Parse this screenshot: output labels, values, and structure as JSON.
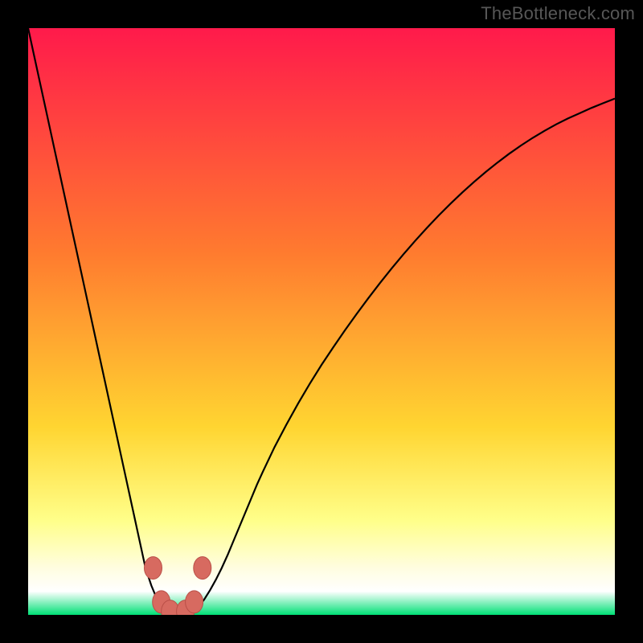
{
  "watermark": "TheBottleneck.com",
  "colors": {
    "frame": "#000000",
    "grad_top": "#ff1a4b",
    "grad_mid1": "#ff7a2f",
    "grad_mid2": "#ffd531",
    "grad_yellow_band": "#ffff8a",
    "grad_cream": "#fffde0",
    "grad_green": "#00e076",
    "curve": "#000000",
    "marker_fill": "#d76a60",
    "marker_stroke": "#b94f47"
  },
  "chart_data": {
    "type": "line",
    "title": "",
    "xlabel": "",
    "ylabel": "",
    "xlim": [
      0,
      100
    ],
    "ylim": [
      0,
      100
    ],
    "x": [
      0,
      1,
      2,
      3,
      4,
      5,
      6,
      7,
      8,
      9,
      10,
      11,
      12,
      13,
      14,
      15,
      16,
      17,
      18,
      19,
      20,
      21,
      22,
      23,
      24,
      25,
      26,
      27,
      28,
      29,
      30,
      31,
      32,
      33,
      34,
      35,
      36,
      37,
      38,
      39,
      40,
      42,
      44,
      46,
      48,
      50,
      52,
      54,
      56,
      58,
      60,
      62,
      64,
      66,
      68,
      70,
      72,
      74,
      76,
      78,
      80,
      82,
      84,
      86,
      88,
      90,
      92,
      94,
      96,
      98,
      100
    ],
    "y": [
      100,
      95.4,
      90.8,
      86.2,
      81.6,
      77.0,
      72.4,
      67.8,
      63.2,
      58.6,
      54.0,
      49.4,
      44.8,
      40.2,
      35.6,
      31.0,
      26.4,
      21.8,
      17.2,
      12.6,
      8.0,
      5.0,
      2.6,
      1.2,
      0.4,
      0.0,
      0.0,
      0.2,
      0.6,
      1.4,
      2.6,
      4.2,
      6.0,
      8.0,
      10.2,
      12.6,
      15.0,
      17.4,
      19.8,
      22.2,
      24.4,
      28.6,
      32.4,
      36.0,
      39.4,
      42.6,
      45.6,
      48.5,
      51.3,
      54.0,
      56.6,
      59.1,
      61.5,
      63.8,
      66.0,
      68.1,
      70.1,
      72.0,
      73.8,
      75.5,
      77.1,
      78.6,
      80.0,
      81.3,
      82.5,
      83.6,
      84.6,
      85.5,
      86.4,
      87.2,
      88.0
    ],
    "markers": [
      {
        "x": 21.3,
        "y": 8.0
      },
      {
        "x": 22.7,
        "y": 2.2
      },
      {
        "x": 24.2,
        "y": 0.6
      },
      {
        "x": 26.8,
        "y": 0.6
      },
      {
        "x": 28.3,
        "y": 2.2
      },
      {
        "x": 29.7,
        "y": 8.0
      }
    ]
  }
}
